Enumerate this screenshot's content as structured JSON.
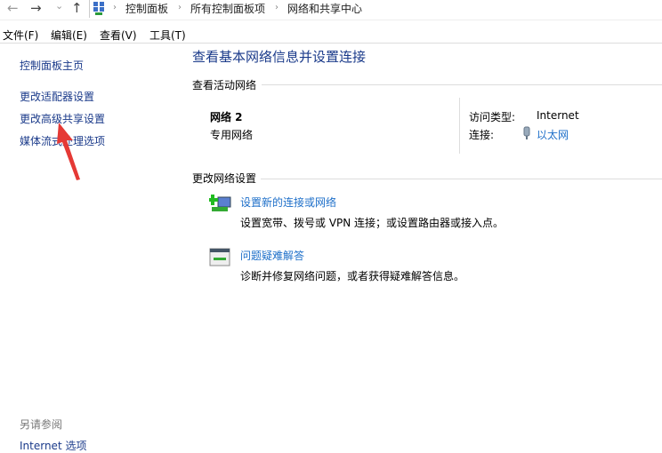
{
  "nav": {
    "back": "←",
    "forward": "→",
    "recent": "⌄",
    "up": "↑"
  },
  "breadcrumb": [
    "控制面板",
    "所有控制面板项",
    "网络和共享中心"
  ],
  "menu": [
    "文件(F)",
    "编辑(E)",
    "查看(V)",
    "工具(T)"
  ],
  "sidebar": {
    "items": [
      "控制面板主页",
      "更改适配器设置",
      "更改高级共享设置",
      "媒体流式处理选项"
    ],
    "see_also": "另请参阅",
    "see_also_items": [
      "Internet 选项"
    ]
  },
  "main": {
    "title": "查看基本网络信息并设置连接",
    "active_header": "查看活动网络",
    "network_name": "网络 2",
    "network_type": "专用网络",
    "access_label": "访问类型:",
    "access_value": "Internet",
    "conn_label": "连接:",
    "conn_value": "以太网",
    "change_header": "更改网络设置",
    "tasks": [
      {
        "title": "设置新的连接或网络",
        "desc": "设置宽带、拨号或 VPN 连接；或设置路由器或接入点。"
      },
      {
        "title": "问题疑难解答",
        "desc": "诊断并修复网络问题，或者获得疑难解答信息。"
      }
    ]
  },
  "colors": {
    "arrow": "#e53935",
    "link": "#1e6fc9"
  }
}
